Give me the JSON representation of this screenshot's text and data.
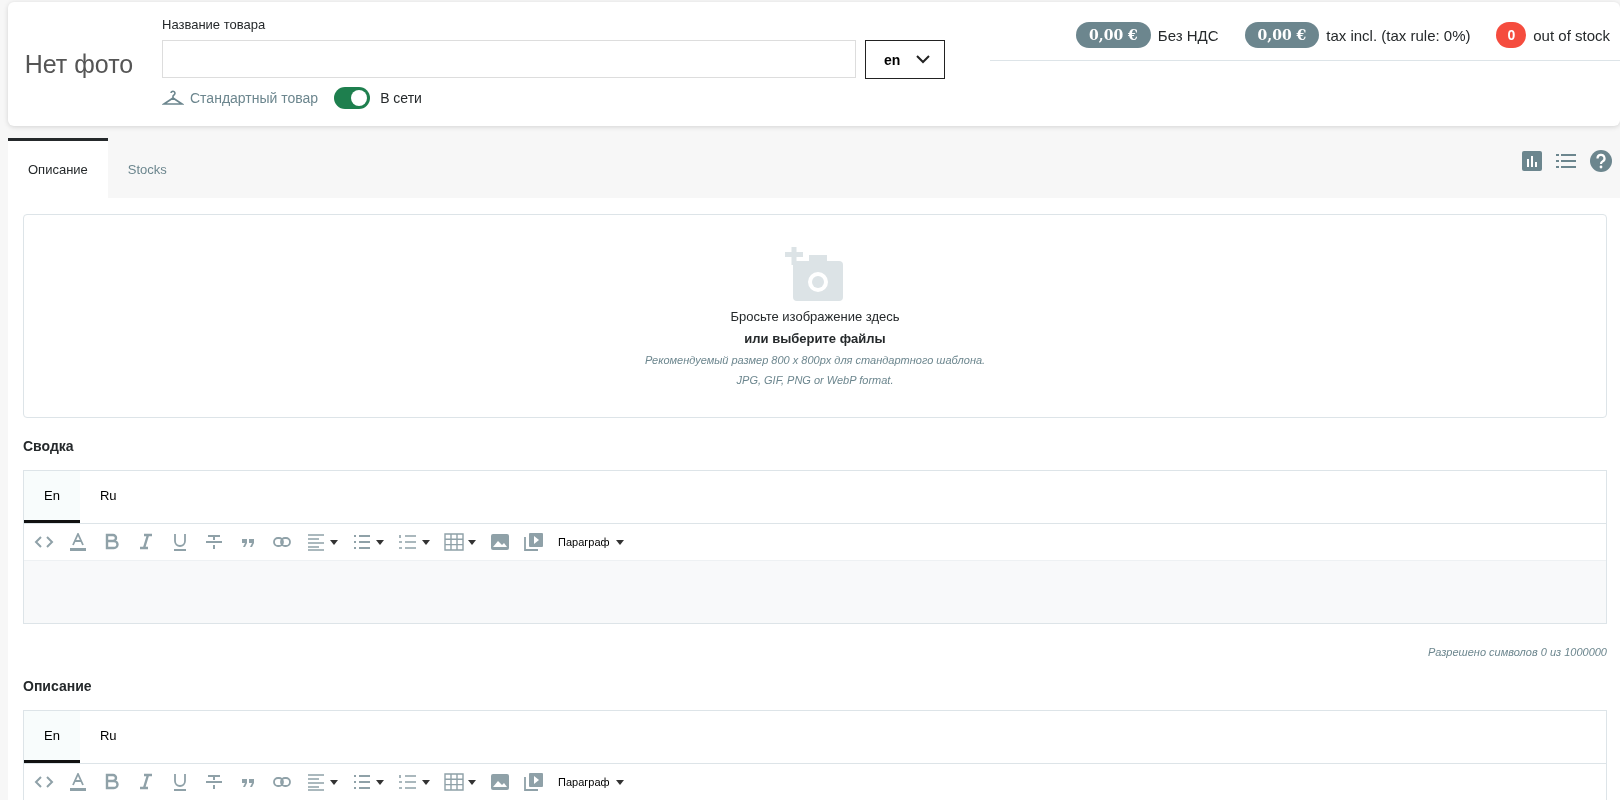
{
  "product": {
    "photo_placeholder": "Нет фото",
    "name_label": "Название товара",
    "language": "en",
    "type": "Стандартный товар",
    "online": {
      "label": "В сети",
      "on": true
    }
  },
  "summary_badges": [
    {
      "kind": "price",
      "value": "0,00 €",
      "label": "Без НДС"
    },
    {
      "kind": "price",
      "value": "0,00 €",
      "label": "tax incl. (tax rule: 0%)"
    },
    {
      "kind": "alert",
      "value": "0",
      "label": "out of stock"
    }
  ],
  "tabs": [
    {
      "label": "Описание",
      "selected": true
    },
    {
      "label": "Stocks",
      "selected": false
    }
  ],
  "dropzone": {
    "title": "Бросьте изображение здесь",
    "link": "или выберите файлы",
    "hint": "Рекомендуемый размер 800 x 800px для стандартного шаблона.",
    "formats": "JPG, GIF, PNG or WebP format."
  },
  "editors": [
    {
      "heading": "Сводка",
      "languages": [
        {
          "label": "En",
          "selected": true
        },
        {
          "label": "Ru",
          "selected": false
        }
      ],
      "format_menu": "Параграф",
      "counter": "Разрешено символов 0 из 1000000"
    },
    {
      "heading": "Описание",
      "languages": [
        {
          "label": "En",
          "selected": true
        },
        {
          "label": "Ru",
          "selected": false
        }
      ],
      "format_menu": "Параграф"
    }
  ]
}
